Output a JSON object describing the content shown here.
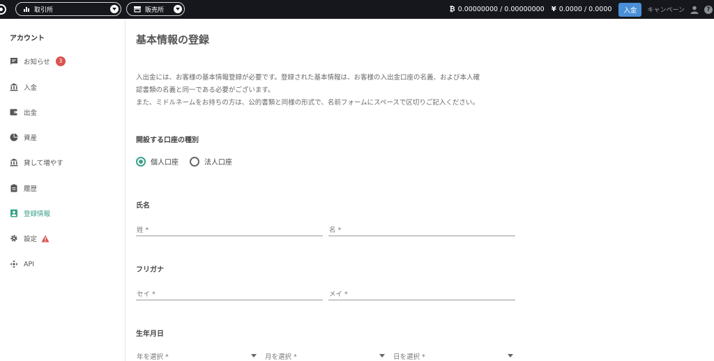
{
  "topbar": {
    "exchange_label": "取引所",
    "sales_label": "販売所",
    "btc_symbol": "₿",
    "btc_balance": "0.00000000 / 0.00000000",
    "jpy_symbol": "¥",
    "jpy_balance": "0.0000 / 0.0000",
    "deposit_label": "入金",
    "campaign_label": "キャンペーン",
    "help_label": "?"
  },
  "sidebar": {
    "title": "アカウント",
    "items": [
      {
        "label": "お知らせ",
        "icon": "message-icon",
        "badge": "3"
      },
      {
        "label": "入金",
        "icon": "bank-icon"
      },
      {
        "label": "出金",
        "icon": "wallet-icon"
      },
      {
        "label": "資産",
        "icon": "pie-chart-icon"
      },
      {
        "label": "貸して増やす",
        "icon": "bank-icon"
      },
      {
        "label": "履歴",
        "icon": "clipboard-icon"
      },
      {
        "label": "登録情報",
        "icon": "id-card-icon",
        "active": true
      },
      {
        "label": "設定",
        "icon": "gear-icon",
        "warning": true
      },
      {
        "label": "API",
        "icon": "move-icon"
      }
    ]
  },
  "main": {
    "title": "基本情報の登録",
    "intro_line1": "入出金には、お客様の基本情報登録が必要です。登録された基本情報は、お客様の入出金口座の名義、および本人確",
    "intro_line2": "認書類の名義と同一である必要がございます。",
    "intro_line3": "また、ミドルネームをお持ちの方は、公的書類と同様の形式で、名前フォームにスペースで区切りご記入ください。",
    "account_type_label": "開設する口座の種別",
    "account_type_options": [
      "個人口座",
      "法人口座"
    ],
    "account_type_selected": "個人口座",
    "name_label": "氏名",
    "last_name_placeholder": "姓 *",
    "first_name_placeholder": "名 *",
    "furigana_label": "フリガナ",
    "last_kana_placeholder": "セイ *",
    "first_kana_placeholder": "メイ *",
    "birthdate_label": "生年月日",
    "year_placeholder": "年を選択 *",
    "month_placeholder": "月を選択 *",
    "day_placeholder": "日を選択 *"
  },
  "colors": {
    "topbar_bg": "#15171d",
    "accent_green": "#3aa18b",
    "deposit_blue": "#4a8fd8",
    "badge_red": "#d9534f"
  }
}
